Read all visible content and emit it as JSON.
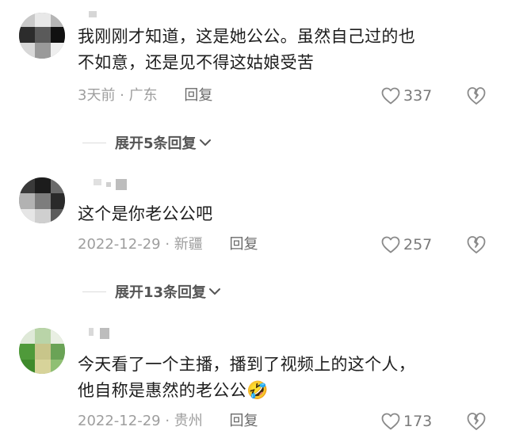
{
  "comments": [
    {
      "text_lines": [
        "我刚刚才知道，这是她公公。虽然自己过的也",
        "不如意，还是见不得这姑娘受苦"
      ],
      "time": "3天前",
      "location": "广东",
      "reply_label": "回复",
      "likes": "337",
      "expand_label": "展开5条回复"
    },
    {
      "text_lines": [
        "这个是你老公公吧"
      ],
      "time": "2022-12-29",
      "location": "新疆",
      "reply_label": "回复",
      "likes": "257",
      "expand_label": "展开13条回复"
    },
    {
      "text_lines": [
        "今天看了一个主播，播到了视频上的这个人，",
        "他自称是惠然的老公公"
      ],
      "emoji": "🤣",
      "time": "2022-12-29",
      "location": "贵州",
      "reply_label": "回复",
      "likes": "173"
    }
  ],
  "icons": {
    "like": "heart-outline-icon",
    "dislike": "broken-heart-icon",
    "expand": "chevron-down-icon"
  },
  "colors": {
    "text": "#1e1e1e",
    "meta": "#9e9e9e",
    "reply": "#6b6b6b",
    "expand": "#555555"
  }
}
